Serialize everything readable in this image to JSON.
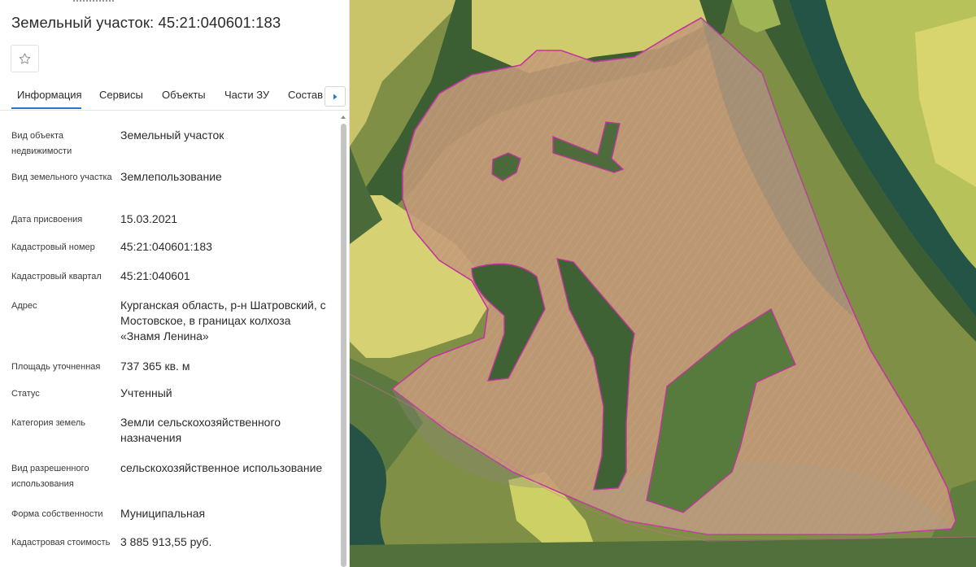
{
  "title": "Земельный участок: 45:21:040601:183",
  "tabs": [
    {
      "label": "Информация"
    },
    {
      "label": "Сервисы"
    },
    {
      "label": "Объекты"
    },
    {
      "label": "Части ЗУ"
    },
    {
      "label": "Состав"
    }
  ],
  "info": {
    "object_type": {
      "label": "Вид объекта недвижимости",
      "value": "Земельный участок"
    },
    "land_kind": {
      "label": "Вид земельного участка",
      "value": "Землепользование"
    },
    "assigned_date": {
      "label": "Дата присвоения",
      "value": "15.03.2021"
    },
    "cadastral_number": {
      "label": "Кадастровый номер",
      "value": "45:21:040601:183"
    },
    "cadastral_quarter": {
      "label": "Кадастровый квартал",
      "value": "45:21:040601"
    },
    "address": {
      "label": "Адрес",
      "value": "Курганская область, р-н Шатровский, с Мостовское, в границах колхоза «Знамя Ленина»"
    },
    "area": {
      "label": "Площадь уточненная",
      "value": "737 365 кв. м"
    },
    "status": {
      "label": "Статус",
      "value": "Учтенный"
    },
    "category": {
      "label": "Категория земель",
      "value": "Земли сельскохозяйственного назначения"
    },
    "permitted_use": {
      "label": "Вид разрешенного использования",
      "value": "сельскохозяйственное использование"
    },
    "ownership": {
      "label": "Форма собственности",
      "value": "Муниципальная"
    },
    "cadastral_value": {
      "label": "Кадастровая стоимость",
      "value": "3 885 913,55 руб."
    }
  },
  "colors": {
    "accent": "#1e7ad6",
    "parcel_fill": "#c49a78",
    "parcel_border": "#c3359e",
    "field_fill": "#d9d86a",
    "river": "#1f5648",
    "forest": "#3f6234"
  },
  "icons": {
    "favorite": "star-icon",
    "tabs_next": "caret-right-icon"
  }
}
